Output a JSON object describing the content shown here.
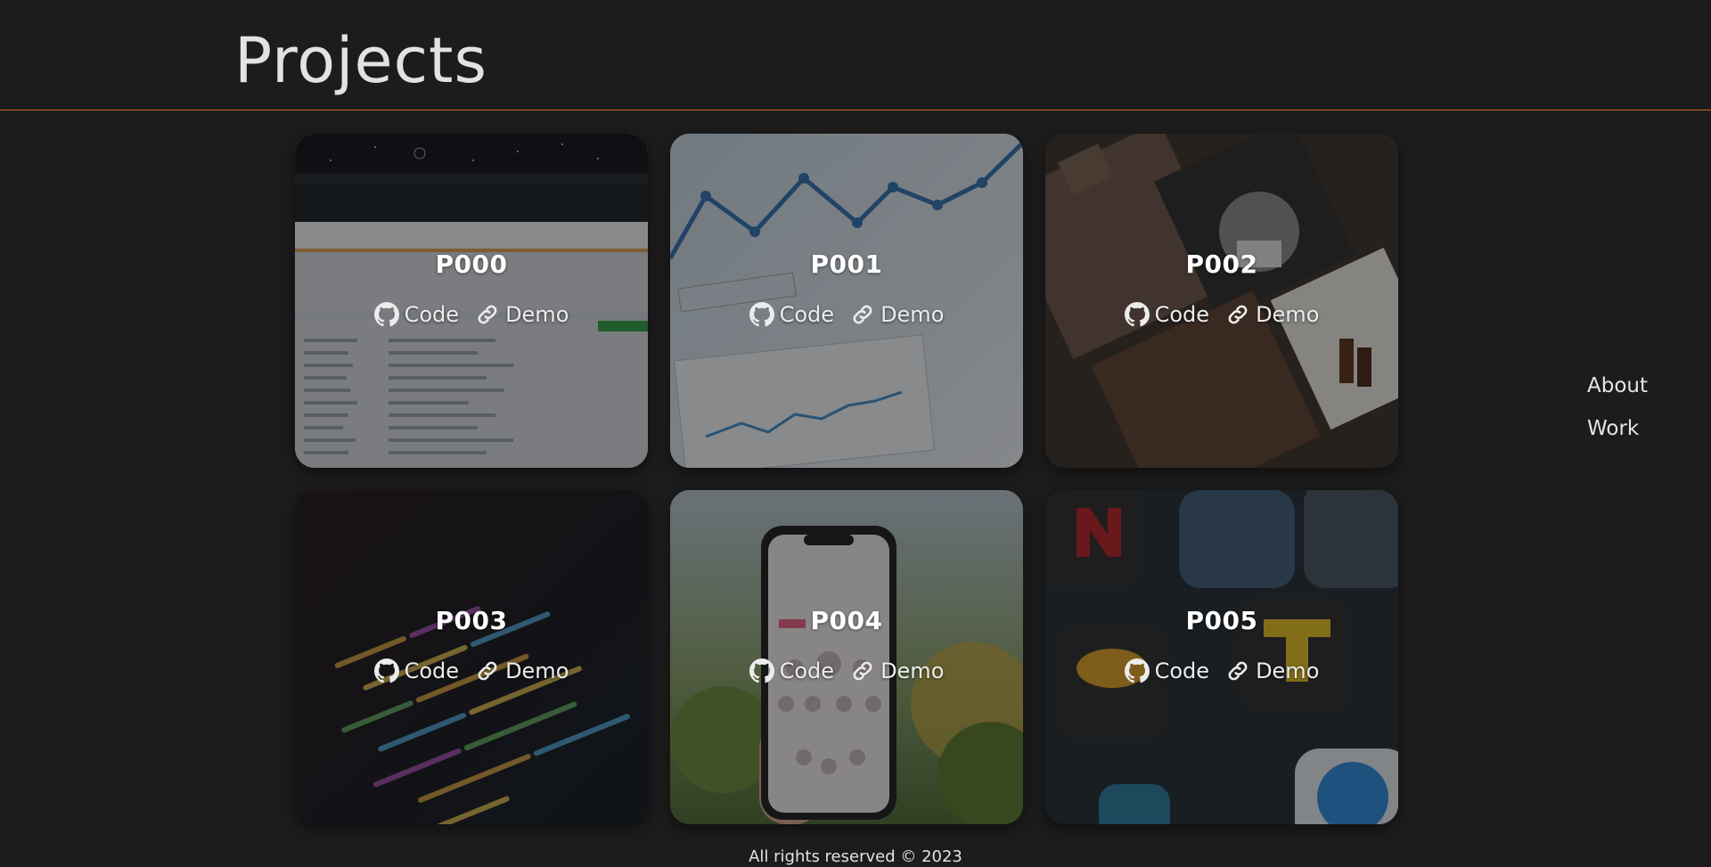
{
  "header": {
    "title": "Projects"
  },
  "nav": {
    "about": "About",
    "work": "Work"
  },
  "projects": [
    {
      "title": "P000",
      "code_label": "Code",
      "demo_label": "Demo"
    },
    {
      "title": "P001",
      "code_label": "Code",
      "demo_label": "Demo"
    },
    {
      "title": "P002",
      "code_label": "Code",
      "demo_label": "Demo"
    },
    {
      "title": "P003",
      "code_label": "Code",
      "demo_label": "Demo"
    },
    {
      "title": "P004",
      "code_label": "Code",
      "demo_label": "Demo"
    },
    {
      "title": "P005",
      "code_label": "Code",
      "demo_label": "Demo"
    }
  ],
  "footer": {
    "text": "All rights reserved © 2023"
  },
  "colors": {
    "background": "#1c1c1c",
    "accent_line": "#c8612a"
  },
  "icons": {
    "code": "github-icon",
    "demo": "link-icon"
  }
}
